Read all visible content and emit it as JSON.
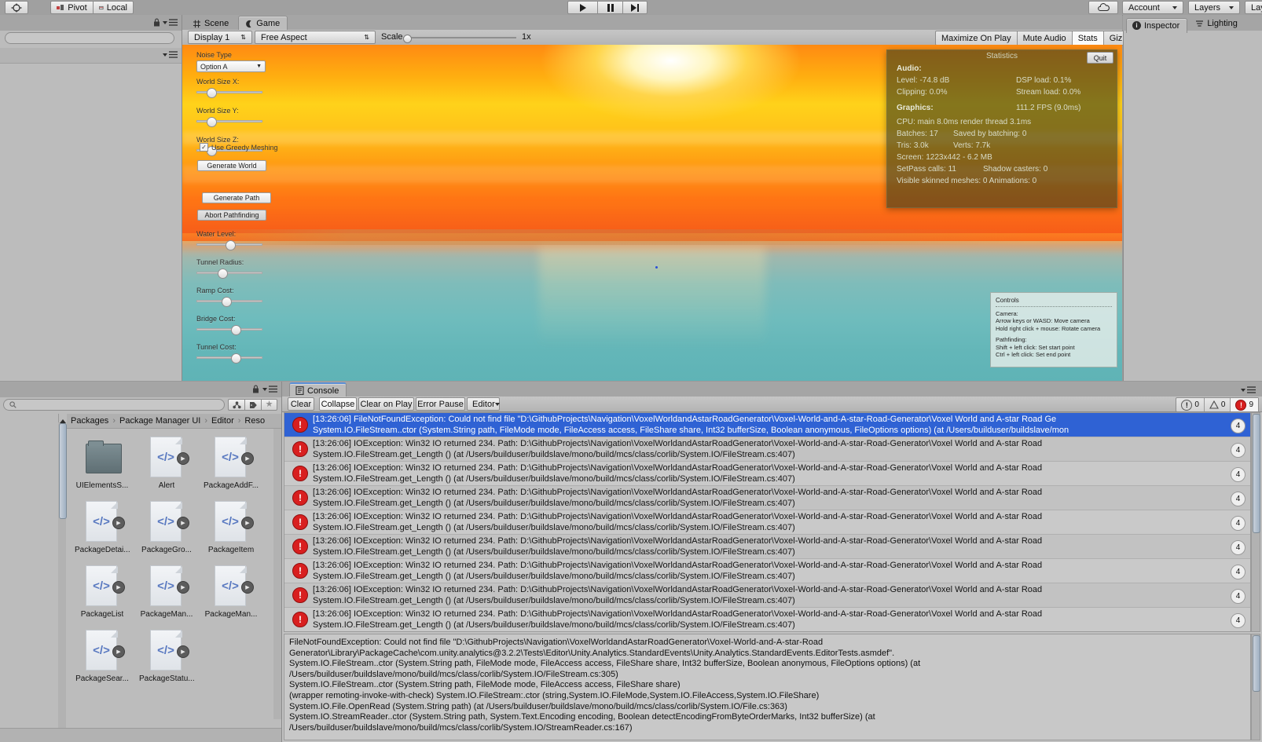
{
  "toolbar": {
    "pivot_label": "Pivot",
    "local_label": "Local",
    "play_icon": "play-icon",
    "pause_icon": "pause-icon",
    "step_icon": "step-icon",
    "cloud_icon": "cloud-icon",
    "account_label": "Account",
    "layers_label": "Layers",
    "layout_label": "Layout"
  },
  "scene_tabs": {
    "scene_label": "Scene",
    "game_label": "Game",
    "lock_icon": "lock-icon",
    "menu_icon": "hamburger-icon"
  },
  "game_toolbar": {
    "display_label": "Display 1",
    "aspect_label": "Free Aspect",
    "scale_label": "Scale",
    "scale_value": "1x",
    "maximize_label": "Maximize On Play",
    "mute_label": "Mute Audio",
    "stats_label": "Stats",
    "gizmos_label": "Gizmos"
  },
  "inspector_tabs": {
    "inspector_label": "Inspector",
    "lighting_label": "Lighting",
    "info_icon": "info-icon"
  },
  "game_gui": {
    "noise_type_label": "Noise Type",
    "noise_type_value": "Option A",
    "sliders_top": [
      {
        "label": "World Size X:",
        "fill": 0.18
      },
      {
        "label": "World Size Y:",
        "fill": 0.18
      },
      {
        "label": "World Size Z:",
        "fill": 0.18
      }
    ],
    "greedy_label": "Use Greedy Meshing",
    "greedy_checked": "✓",
    "generate_world_label": "Generate World",
    "generate_path_label": "Generate Path",
    "abort_path_label": "Abort Pathfinding",
    "sliders_bottom": [
      {
        "label": "Water Level:",
        "fill": 0.5
      },
      {
        "label": "Tunnel Radius:",
        "fill": 0.37
      },
      {
        "label": "Ramp Cost:",
        "fill": 0.44
      },
      {
        "label": "Bridge Cost:",
        "fill": 0.6
      },
      {
        "label": "Tunnel Cost:",
        "fill": 0.6
      }
    ]
  },
  "statistics": {
    "title": "Statistics",
    "quit_label": "Quit",
    "audio_header": "Audio:",
    "level_label": "Level: -74.8 dB",
    "dsp_label": "DSP load: 0.1%",
    "clipping_label": "Clipping: 0.0%",
    "stream_label": "Stream load: 0.0%",
    "graphics_header": "Graphics:",
    "fps_label": "111.2 FPS (9.0ms)",
    "cpu_label": "CPU: main 8.0ms  render thread 3.1ms",
    "batches_label": "Batches: 17",
    "saved_batching_label": "Saved by batching: 0",
    "tris_label": "Tris: 3.0k",
    "verts_label": "Verts: 7.7k",
    "screen_label": "Screen: 1223x442 - 6.2 MB",
    "setpass_label": "SetPass calls: 11",
    "shadow_label": "Shadow casters: 0",
    "skinned_label": "Visible skinned meshes: 0  Animations: 0"
  },
  "controls_overlay": {
    "title": "Controls",
    "camera_header": "Camera:",
    "camera_line1": "Arrow keys or WASD: Move camera",
    "camera_line2": "Hold right click + mouse: Rotate camera",
    "path_header": "Pathfinding:",
    "path_line1": "Shift + left click: Set start point",
    "path_line2": "Ctrl + left click: Set end point"
  },
  "console": {
    "tab_label": "Console",
    "tab_icon": "console-icon",
    "clear_label": "Clear",
    "collapse_label": "Collapse",
    "clear_on_play_label": "Clear on Play",
    "error_pause_label": "Error Pause",
    "editor_label": "Editor",
    "counts": {
      "info": "0",
      "warning": "0",
      "error": "9"
    },
    "rows": [
      {
        "selected": true,
        "badge": "4",
        "line1": "[13:26:06] FileNotFoundException: Could not find file \"D:\\GithubProjects\\Navigation\\VoxelWorldandAstarRoadGenerator\\Voxel-World-and-A-star-Road-Generator\\Voxel World and A-star Road Ge",
        "line2": "System.IO.FileStream..ctor (System.String path, FileMode mode, FileAccess access, FileShare share, Int32 bufferSize, Boolean anonymous, FileOptions options) (at /Users/builduser/buildslave/mon"
      },
      {
        "selected": false,
        "badge": "4",
        "line1": "[13:26:06] IOException: Win32 IO returned 234. Path: D:\\GithubProjects\\Navigation\\VoxelWorldandAstarRoadGenerator\\Voxel-World-and-A-star-Road-Generator\\Voxel World and A-star Road",
        "line2": "System.IO.FileStream.get_Length () (at /Users/builduser/buildslave/mono/build/mcs/class/corlib/System.IO/FileStream.cs:407)"
      },
      {
        "selected": false,
        "badge": "4",
        "line1": "[13:26:06] IOException: Win32 IO returned 234. Path: D:\\GithubProjects\\Navigation\\VoxelWorldandAstarRoadGenerator\\Voxel-World-and-A-star-Road-Generator\\Voxel World and A-star Road",
        "line2": "System.IO.FileStream.get_Length () (at /Users/builduser/buildslave/mono/build/mcs/class/corlib/System.IO/FileStream.cs:407)"
      },
      {
        "selected": false,
        "badge": "4",
        "line1": "[13:26:06] IOException: Win32 IO returned 234. Path: D:\\GithubProjects\\Navigation\\VoxelWorldandAstarRoadGenerator\\Voxel-World-and-A-star-Road-Generator\\Voxel World and A-star Road",
        "line2": "System.IO.FileStream.get_Length () (at /Users/builduser/buildslave/mono/build/mcs/class/corlib/System.IO/FileStream.cs:407)"
      },
      {
        "selected": false,
        "badge": "4",
        "line1": "[13:26:06] IOException: Win32 IO returned 234. Path: D:\\GithubProjects\\Navigation\\VoxelWorldandAstarRoadGenerator\\Voxel-World-and-A-star-Road-Generator\\Voxel World and A-star Road",
        "line2": "System.IO.FileStream.get_Length () (at /Users/builduser/buildslave/mono/build/mcs/class/corlib/System.IO/FileStream.cs:407)"
      },
      {
        "selected": false,
        "badge": "4",
        "line1": "[13:26:06] IOException: Win32 IO returned 234. Path: D:\\GithubProjects\\Navigation\\VoxelWorldandAstarRoadGenerator\\Voxel-World-and-A-star-Road-Generator\\Voxel World and A-star Road",
        "line2": "System.IO.FileStream.get_Length () (at /Users/builduser/buildslave/mono/build/mcs/class/corlib/System.IO/FileStream.cs:407)"
      },
      {
        "selected": false,
        "badge": "4",
        "line1": "[13:26:06] IOException: Win32 IO returned 234. Path: D:\\GithubProjects\\Navigation\\VoxelWorldandAstarRoadGenerator\\Voxel-World-and-A-star-Road-Generator\\Voxel World and A-star Road",
        "line2": "System.IO.FileStream.get_Length () (at /Users/builduser/buildslave/mono/build/mcs/class/corlib/System.IO/FileStream.cs:407)"
      },
      {
        "selected": false,
        "badge": "4",
        "line1": "[13:26:06] IOException: Win32 IO returned 234. Path: D:\\GithubProjects\\Navigation\\VoxelWorldandAstarRoadGenerator\\Voxel-World-and-A-star-Road-Generator\\Voxel World and A-star Road",
        "line2": "System.IO.FileStream.get_Length () (at /Users/builduser/buildslave/mono/build/mcs/class/corlib/System.IO/FileStream.cs:407)"
      },
      {
        "selected": false,
        "badge": "4",
        "line1": "[13:26:06] IOException: Win32 IO returned 234. Path: D:\\GithubProjects\\Navigation\\VoxelWorldandAstarRoadGenerator\\Voxel-World-and-A-star-Road-Generator\\Voxel World and A-star Road",
        "line2": "System.IO.FileStream.get_Length () (at /Users/builduser/buildslave/mono/build/mcs/class/corlib/System.IO/FileStream.cs:407)"
      }
    ],
    "detail": "FileNotFoundException: Could not find file \"D:\\GithubProjects\\Navigation\\VoxelWorldandAstarRoadGenerator\\Voxel-World-and-A-star-Road\nGenerator\\Library\\PackageCache\\com.unity.analytics@3.2.2\\Tests\\Editor\\Unity.Analytics.StandardEvents\\Unity.Analytics.StandardEvents.EditorTests.asmdef\".\nSystem.IO.FileStream..ctor (System.String path, FileMode mode, FileAccess access, FileShare share, Int32 bufferSize, Boolean anonymous, FileOptions options) (at\n/Users/builduser/buildslave/mono/build/mcs/class/corlib/System.IO/FileStream.cs:305)\nSystem.IO.FileStream..ctor (System.String path, FileMode mode, FileAccess access, FileShare share)\n(wrapper remoting-invoke-with-check) System.IO.FileStream:.ctor (string,System.IO.FileMode,System.IO.FileAccess,System.IO.FileShare)\nSystem.IO.File.OpenRead (System.String path) (at /Users/builduser/buildslave/mono/build/mcs/class/corlib/System.IO/File.cs:363)\nSystem.IO.StreamReader..ctor (System.String path, System.Text.Encoding encoding, Boolean detectEncodingFromByteOrderMarks, Int32 bufferSize) (at\n/Users/builduser/buildslave/mono/build/mcs/class/corlib/System.IO/StreamReader.cs:167)"
  },
  "project": {
    "search_placeholder": "",
    "search_icon": "search-icon",
    "filter_type_icon": "filter-type-icon",
    "filter_label_icon": "filter-label-icon",
    "favorite_icon": "star-icon",
    "lock_icon": "lock-icon",
    "menu_icon": "hamburger-icon",
    "breadcrumb": [
      "Packages",
      "Package Manager UI",
      "Editor",
      "Reso"
    ],
    "assets": [
      {
        "name": "UIElementsS...",
        "kind": "folder"
      },
      {
        "name": "Alert",
        "kind": "script"
      },
      {
        "name": "PackageAddF...",
        "kind": "script"
      },
      {
        "name": "PackageDetai...",
        "kind": "script"
      },
      {
        "name": "PackageGro...",
        "kind": "script"
      },
      {
        "name": "PackageItem",
        "kind": "script"
      },
      {
        "name": "PackageList",
        "kind": "script"
      },
      {
        "name": "PackageMan...",
        "kind": "script"
      },
      {
        "name": "PackageMan...",
        "kind": "script"
      },
      {
        "name": "PackageSear...",
        "kind": "script"
      },
      {
        "name": "PackageStatu...",
        "kind": "script"
      }
    ],
    "script_glyph": "</>",
    "play_glyph": "▶"
  }
}
